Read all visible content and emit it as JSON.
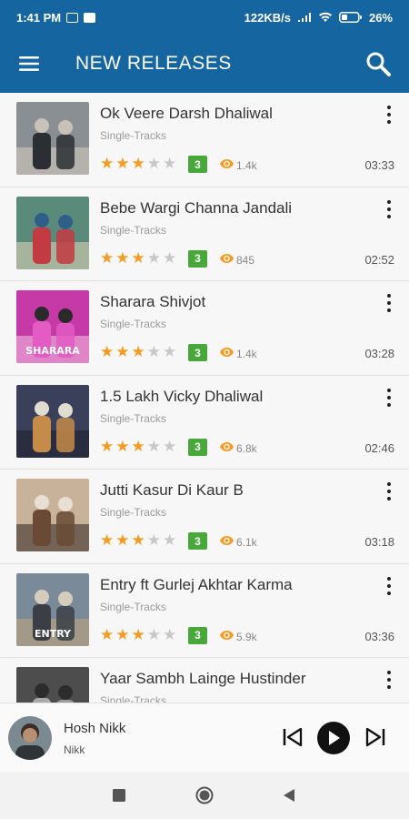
{
  "status": {
    "time": "1:41 PM",
    "speed": "122KB/s",
    "battery": "26%"
  },
  "header": {
    "title": "NEW RELEASES"
  },
  "colors": {
    "primary": "#1565a0",
    "star": "#f39c21",
    "badge": "#48a83a"
  },
  "tracks": [
    {
      "title": "Ok Veere Darsh Dhaliwal",
      "subtitle": "Single-Tracks",
      "rating": "3",
      "views": "1.4k",
      "duration": "03:33",
      "thumb_icon": "album-art"
    },
    {
      "title": "Bebe Wargi Channa Jandali",
      "subtitle": "Single-Tracks",
      "rating": "3",
      "views": "845",
      "duration": "02:52",
      "thumb_icon": "album-art"
    },
    {
      "title": "Sharara Shivjot",
      "subtitle": "Single-Tracks",
      "rating": "3",
      "views": "1.4k",
      "duration": "03:28",
      "thumb_icon": "album-art",
      "thumb_text": "SHARARA"
    },
    {
      "title": "1.5 Lakh Vicky Dhaliwal",
      "subtitle": "Single-Tracks",
      "rating": "3",
      "views": "6.8k",
      "duration": "02:46",
      "thumb_icon": "album-art"
    },
    {
      "title": "Jutti Kasur Di Kaur B",
      "subtitle": "Single-Tracks",
      "rating": "3",
      "views": "6.1k",
      "duration": "03:18",
      "thumb_icon": "album-art"
    },
    {
      "title": "Entry ft Gurlej Akhtar Karma",
      "subtitle": "Single-Tracks",
      "rating": "3",
      "views": "5.9k",
      "duration": "03:36",
      "thumb_icon": "album-art",
      "thumb_text": "ENTRY"
    },
    {
      "title": "Yaar Sambh Lainge Hustinder",
      "subtitle": "Single-Tracks",
      "rating": "",
      "views": "",
      "duration": "",
      "thumb_icon": "album-art"
    }
  ],
  "player": {
    "title": "Hosh Nikk",
    "artist": "Nikk"
  }
}
